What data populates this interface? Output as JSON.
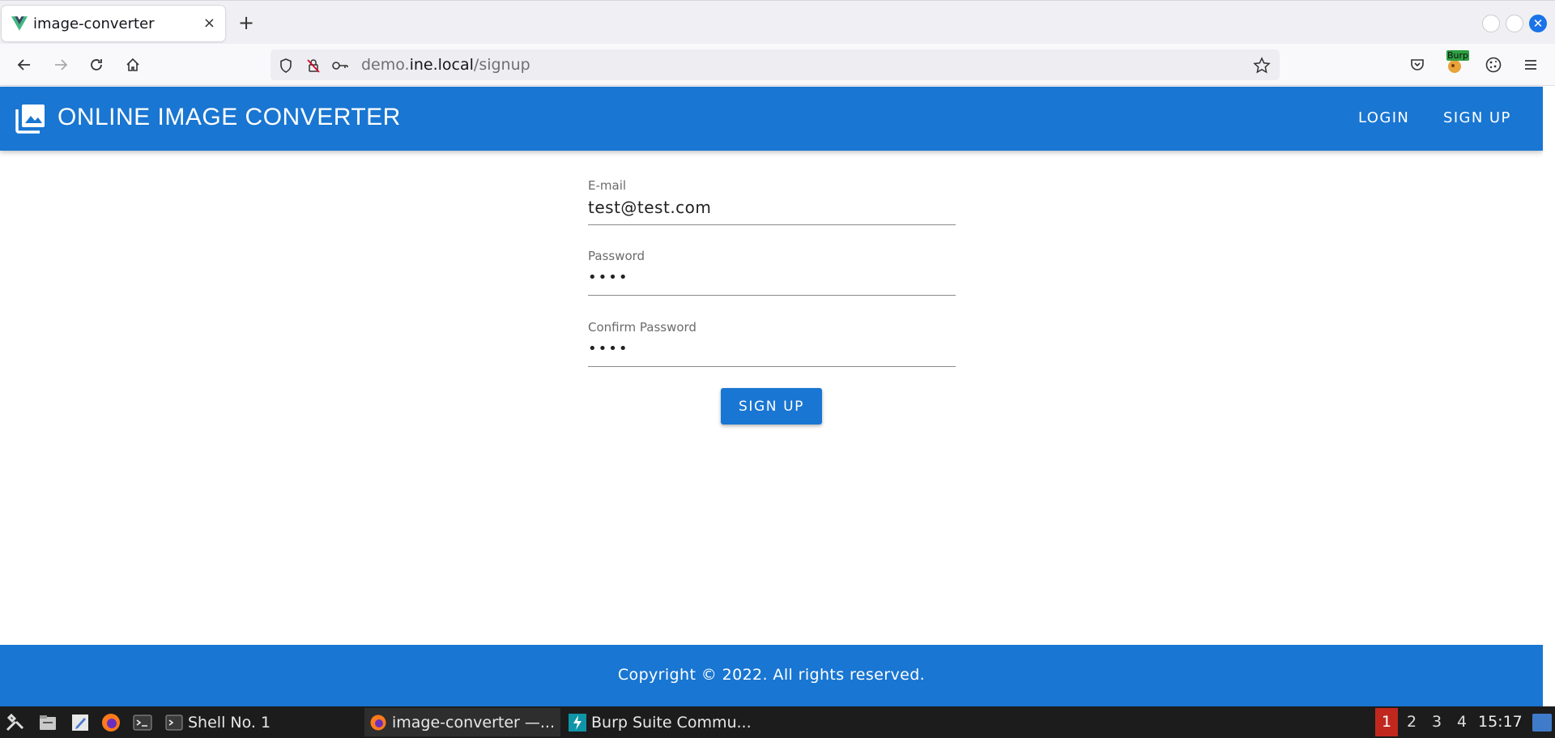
{
  "browser": {
    "tab_title": "image-converter",
    "tab_close": "×",
    "new_tab": "+",
    "url_scheme_sub": "demo.",
    "url_host": "ine.local",
    "url_path": "/signup",
    "burp_label": "Burp"
  },
  "app": {
    "title": "ONLINE IMAGE CONVERTER",
    "nav": {
      "login": "LOGIN",
      "signup": "SIGN UP"
    }
  },
  "form": {
    "email_label": "E-mail",
    "email_value": "test@test.com",
    "password_label": "Password",
    "password_value": "••••",
    "confirm_label": "Confirm Password",
    "confirm_value": "••••",
    "submit_label": "SIGN UP"
  },
  "footer": {
    "text": "Copyright © 2022. All rights reserved."
  },
  "taskbar": {
    "tasks": [
      {
        "label": "Shell No. 1"
      },
      {
        "label": "image-converter —..."
      },
      {
        "label": "Burp Suite Commu..."
      }
    ],
    "workspaces": [
      "1",
      "2",
      "3",
      "4"
    ],
    "clock": "15:17"
  },
  "colors": {
    "primary": "#1976d2",
    "taskbar": "#1c1c1c",
    "active_workspace": "#c0281f"
  }
}
